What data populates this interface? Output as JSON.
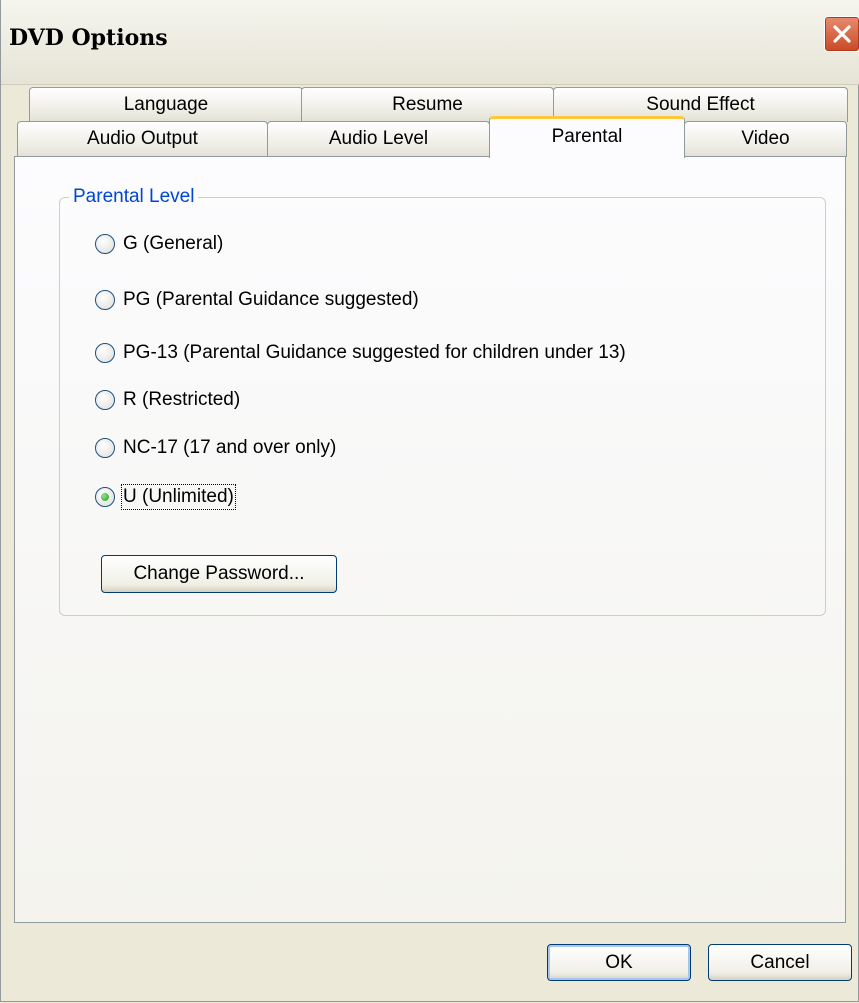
{
  "window": {
    "title": "DVD Options",
    "close_icon": "close-icon",
    "colors": {
      "title_bar": "#f6f5ee",
      "close_button": "#d45f3d",
      "tab_highlight": "#ffc83c",
      "group_label": "#0046d5",
      "radio_check": "#21a121"
    }
  },
  "tabs": {
    "row1": [
      {
        "label": "Language"
      },
      {
        "label": "Resume"
      },
      {
        "label": "Sound Effect"
      }
    ],
    "row2": [
      {
        "label": "Audio Output"
      },
      {
        "label": "Audio Level"
      },
      {
        "label": "Parental",
        "active": true
      },
      {
        "label": "Video"
      }
    ]
  },
  "parental": {
    "group_label": "Parental Level",
    "options": [
      {
        "label": "G (General)",
        "checked": false
      },
      {
        "label": "PG (Parental Guidance suggested)",
        "checked": false
      },
      {
        "label": "PG-13 (Parental Guidance suggested for children under 13)",
        "checked": false
      },
      {
        "label": "R (Restricted)",
        "checked": false
      },
      {
        "label": "NC-17 (17 and over only)",
        "checked": false
      },
      {
        "label": "U (Unlimited)",
        "checked": true
      }
    ],
    "change_password_label": "Change Password..."
  },
  "footer": {
    "ok_label": "OK",
    "cancel_label": "Cancel"
  }
}
